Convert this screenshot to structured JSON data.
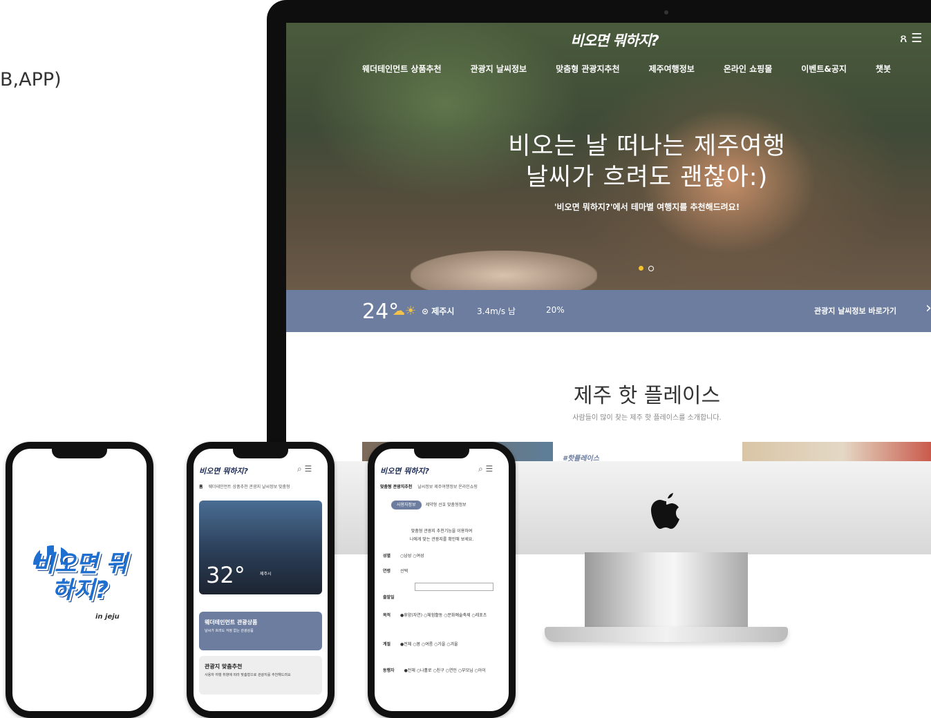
{
  "caption": "B,APP)",
  "site": {
    "logo": "비오면 뭐하지?",
    "top_icons": "ጸ ☰",
    "nav": [
      "웨더테인먼트 상품추천",
      "관광지 날씨정보",
      "맞춤형 관광지추천",
      "제주여행정보",
      "온라인 쇼핑몰",
      "이벤트&공지",
      "챗봇"
    ],
    "hero_line1": "비오는 날 떠나는 제주여행",
    "hero_line2": "날씨가 흐려도 괜찮아:)",
    "hero_sub": "'비오면 뭐하지?'에서 테마별 여행지를 추천해드려요!",
    "weather": {
      "temp": "24°",
      "icon": "☁☀",
      "location": "⊙ 제주시",
      "wind": "3.4m/s 남",
      "rain": "20%",
      "link": "관광지 날씨정보 바로가기",
      "arrow": "›"
    },
    "hot_title": "제주 핫 플레이스",
    "hot_sub": "사람들이 많이 찾는 제주 핫 플레이스를 소개합니다.",
    "thumb_tag": "#핫플레이스"
  },
  "phone1": {
    "logo": "비오면 뭐하지?",
    "sub": "in jeju"
  },
  "phone2": {
    "logo": "비오면 뭐하지?",
    "icons": "⌕ ☰",
    "nav_active": "홈",
    "nav": "웨더테인먼트 상품추천  관광지 날씨정보  맞춤형",
    "temp": "32°",
    "loc": "제주시",
    "card1_title": "웨더테인먼트 관광상품",
    "card1_desc": "날씨가 흐려도 걱정 없는 관광상품",
    "card2_title": "관광지 맞춤추천",
    "card2_desc": "사용자 여행 취향에 따라 맞춤형으로 관광지를 추천해드려요"
  },
  "phone3": {
    "logo": "비오면 뭐하지?",
    "icons": "⌕ ☰",
    "nav_active": "맞춤형 관광지추천",
    "nav": "날씨정보  제주여행정보  온라인쇼핑",
    "tab_active": "사용자정보",
    "tabs": "제약형  선호  맞춤형정보",
    "intro1": "맞춤형 관광지 추천기능을 이용하여",
    "intro2": "나에게 맞는 관광지를 확인해 보세요.",
    "rows": [
      {
        "label": "성별",
        "value": "○남성 ○여성"
      },
      {
        "label": "연령",
        "value": "선택"
      },
      {
        "label": "출발일",
        "value": ""
      },
      {
        "label": "목적",
        "value": "●휴양(자연) ○체험활동 ○문화예술축제 ○레포츠"
      },
      {
        "label": "계절",
        "value": "●전체 ○봄 ○여름 ○가을 ○겨울"
      },
      {
        "label": "동행자",
        "value": "●전체 ○나홀로 ○친구 ○연인 ○부모님 ○아이"
      }
    ]
  }
}
